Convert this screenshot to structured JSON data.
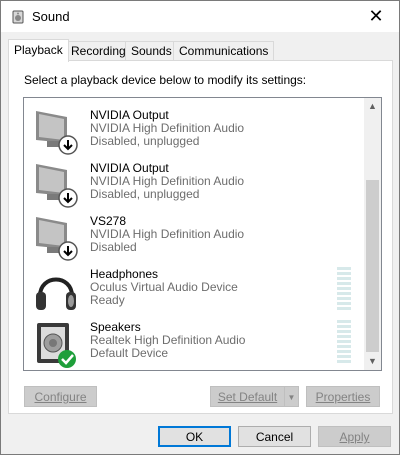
{
  "window": {
    "title": "Sound"
  },
  "tabs": [
    {
      "label": "Playback",
      "active": true
    },
    {
      "label": "Recording"
    },
    {
      "label": "Sounds"
    },
    {
      "label": "Communications"
    }
  ],
  "instruction": "Select a playback device below to modify its settings:",
  "devices": [
    {
      "name": "NVIDIA Output",
      "description": "NVIDIA High Definition Audio",
      "status": "Disabled, unplugged",
      "icon": "monitor-icon",
      "badge": "down-arrow-badge-icon"
    },
    {
      "name": "NVIDIA Output",
      "description": "NVIDIA High Definition Audio",
      "status": "Disabled, unplugged",
      "icon": "monitor-icon",
      "badge": "down-arrow-badge-icon"
    },
    {
      "name": "VS278",
      "description": "NVIDIA High Definition Audio",
      "status": "Disabled",
      "icon": "monitor-icon",
      "badge": "down-arrow-badge-icon"
    },
    {
      "name": "Headphones",
      "description": "Oculus Virtual Audio Device",
      "status": "Ready",
      "icon": "headphones-icon",
      "badge": ""
    },
    {
      "name": "Speakers",
      "description": "Realtek High Definition Audio",
      "status": "Default Device",
      "icon": "speaker-icon",
      "badge": "green-check-badge-icon"
    }
  ],
  "buttons": {
    "configure": "Configure",
    "set_default": "Set Default",
    "properties": "Properties",
    "ok": "OK",
    "cancel": "Cancel",
    "apply": "Apply"
  },
  "colors": {
    "accent": "#0078d7",
    "check_badge": "#1e9f3a"
  }
}
